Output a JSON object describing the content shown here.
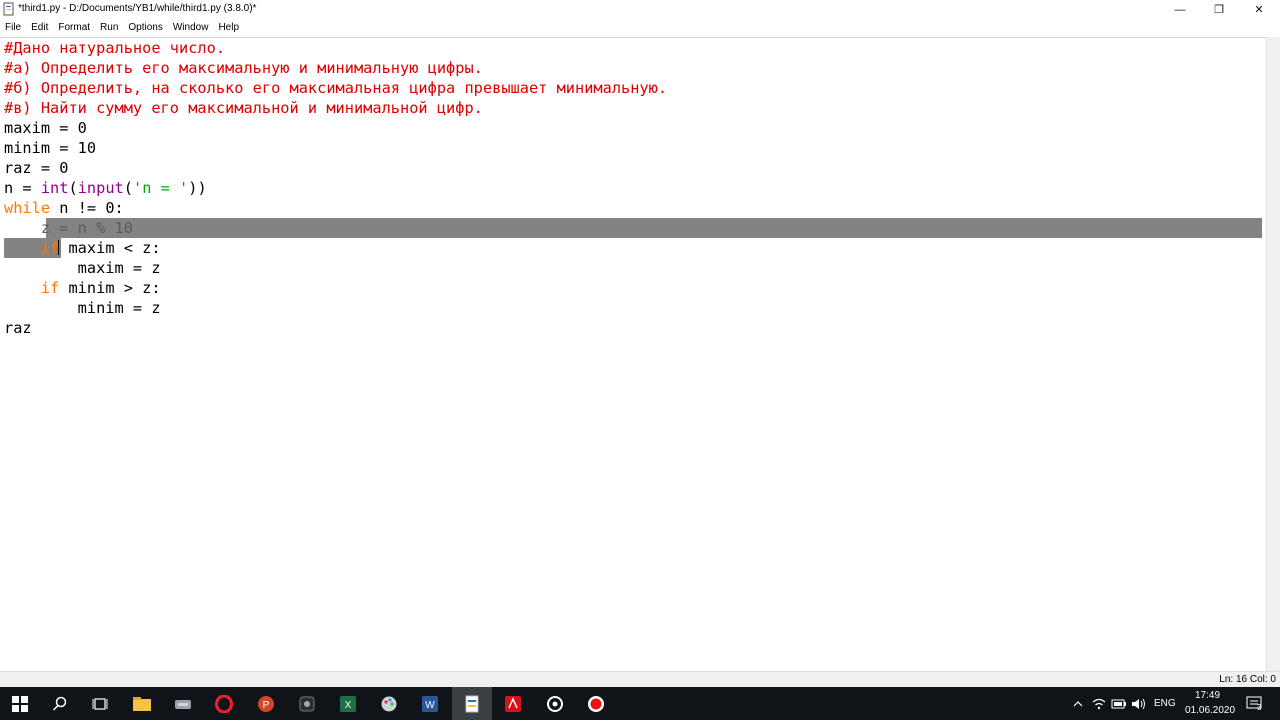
{
  "window": {
    "title": "*third1.py - D:/Documents/YB1/while/third1.py (3.8.0)*",
    "minimize_symbol": "—",
    "maximize_symbol": "❐",
    "close_symbol": "✕"
  },
  "menu": [
    "File",
    "Edit",
    "Format",
    "Run",
    "Options",
    "Window",
    "Help"
  ],
  "code": {
    "lines": [
      "#Дано натуральное число.",
      "#а) Определить его максимальную и минимальную цифры.",
      "#б) Определить, на сколько его максимальная цифра превышает минимальную.",
      "#в) Найти сумму его максимальной и минимальной цифр.",
      "maxim = 0",
      "minim = 10",
      "raz = 0",
      "n = int(input('n = '))",
      "while n != 0:",
      "    z = n % 10",
      "    if maxim < z:",
      "        maxim = z",
      "    if minim > z:",
      "        minim = z",
      "raz"
    ],
    "colors": {
      "comment": "#dd0000",
      "keyword": "#ff7700",
      "builtin": "#900090",
      "string": "#00aa00",
      "selection": "#838383"
    }
  },
  "status": {
    "text": "Ln: 16   Col: 0"
  },
  "taskbar": {
    "icons": [
      "windows-start-icon",
      "search-icon",
      "task-view-icon",
      "file-explorer-icon",
      "network-drive-icon",
      "opera-icon",
      "powerpoint-icon",
      "app-icon",
      "excel-icon",
      "paint-icon",
      "word-icon",
      "python-idle-icon",
      "acrobat-icon",
      "media-icon",
      "recorder-icon"
    ],
    "language": "ENG",
    "time": "17:49",
    "date": "01.06.2020",
    "notifications": "3"
  }
}
